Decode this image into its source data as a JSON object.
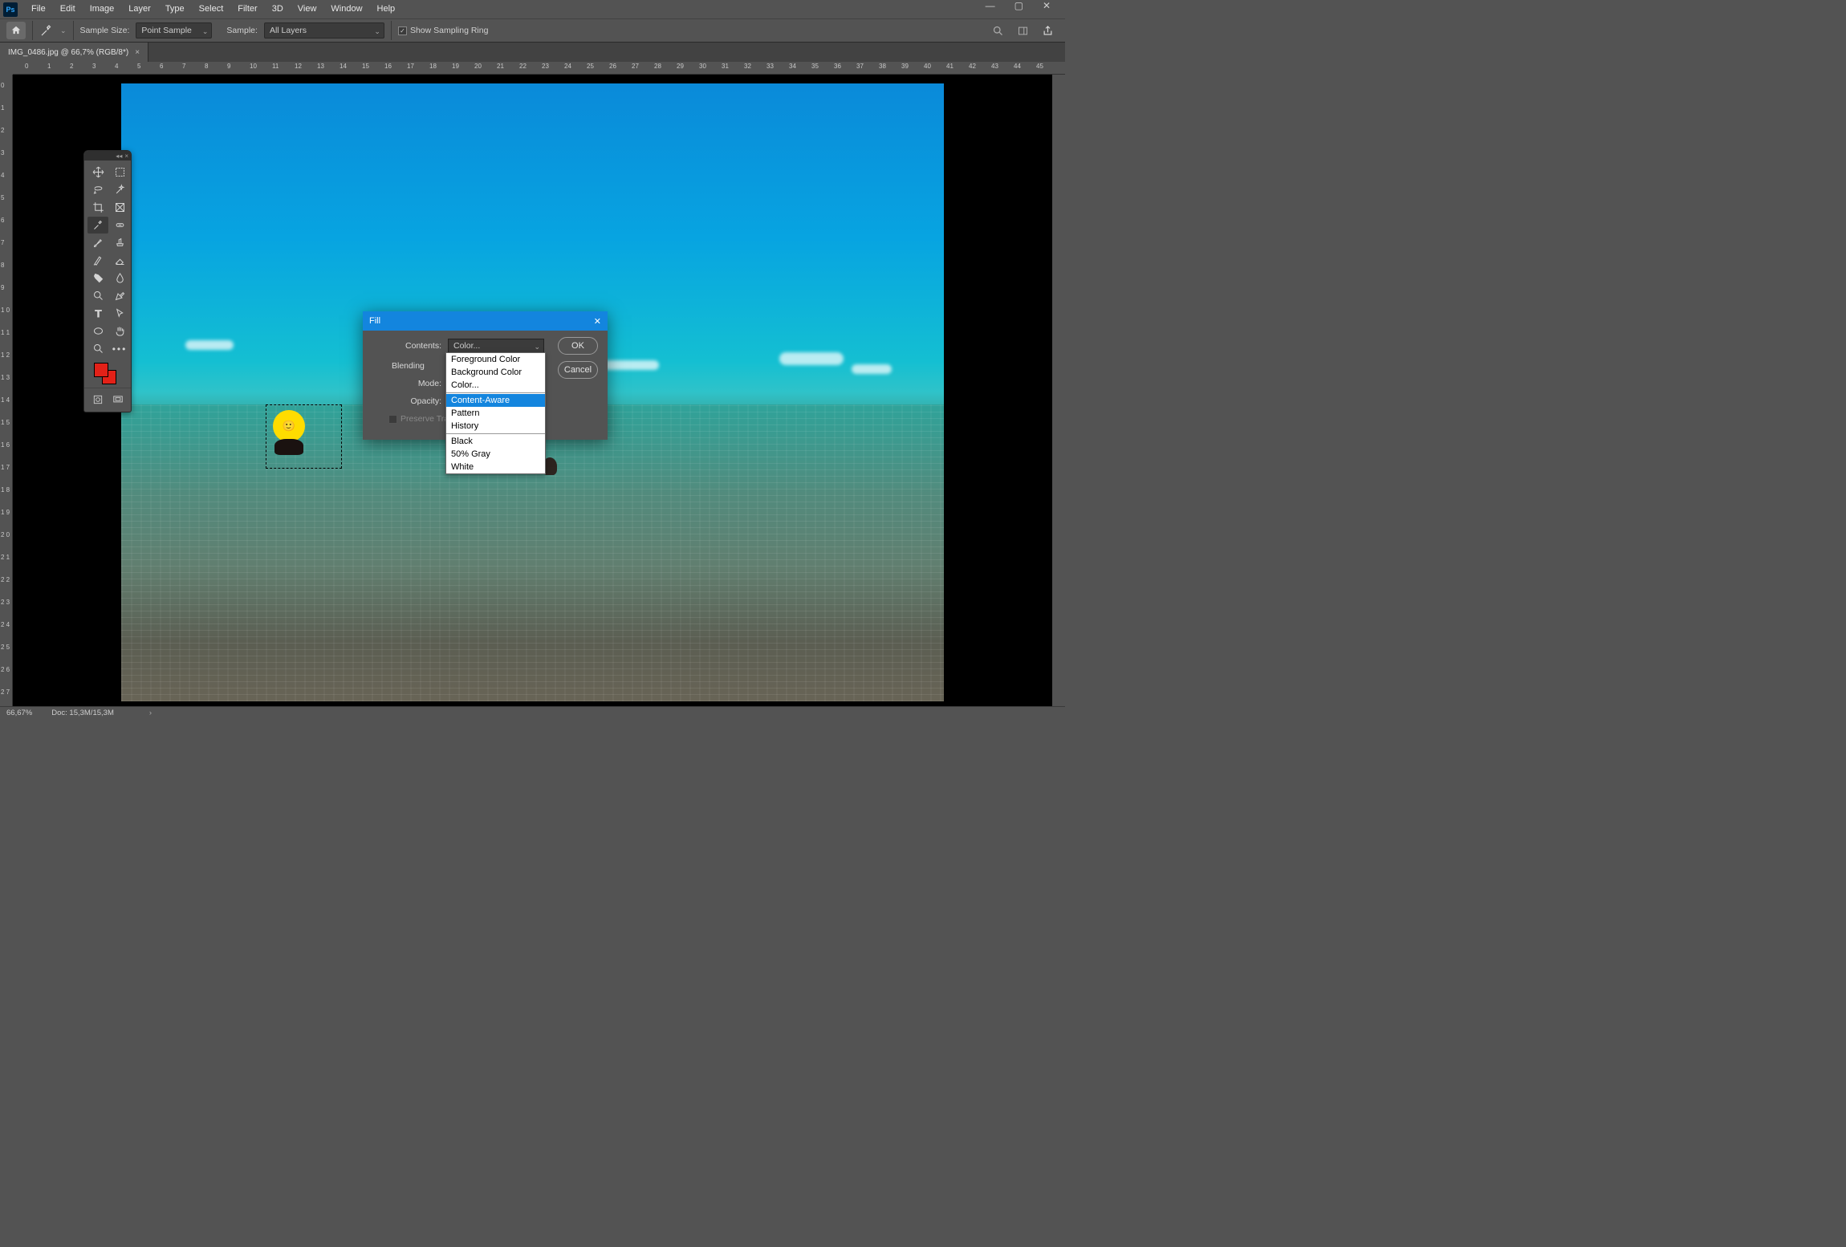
{
  "menu": [
    "File",
    "Edit",
    "Image",
    "Layer",
    "Type",
    "Select",
    "Filter",
    "3D",
    "View",
    "Window",
    "Help"
  ],
  "optbar": {
    "sample_size_label": "Sample Size:",
    "sample_size_value": "Point Sample",
    "sample_label": "Sample:",
    "sample_value": "All Layers",
    "show_ring_label": "Show Sampling Ring"
  },
  "tab": {
    "title": "IMG_0486.jpg @ 66,7% (RGB/8*)"
  },
  "ruler_ticks": [
    "0",
    "1",
    "2",
    "3",
    "4",
    "5",
    "6",
    "7",
    "8",
    "9",
    "10",
    "11",
    "12",
    "13",
    "14",
    "15",
    "16",
    "17",
    "18",
    "19",
    "20",
    "21",
    "22",
    "23",
    "24",
    "25",
    "26",
    "27",
    "28",
    "29",
    "30",
    "31",
    "32",
    "33",
    "34",
    "35",
    "36",
    "37",
    "38",
    "39",
    "40",
    "41",
    "42",
    "43",
    "44",
    "45"
  ],
  "ruler_ticks_v": [
    "0",
    "1",
    "2",
    "3",
    "4",
    "5",
    "6",
    "7",
    "8",
    "9",
    "1 0",
    "1 1",
    "1 2",
    "1 3",
    "1 4",
    "1 5",
    "1 6",
    "1 7",
    "1 8",
    "1 9",
    "2 0",
    "2 1",
    "2 2",
    "2 3",
    "2 4",
    "2 5",
    "2 6",
    "2 7"
  ],
  "swatches": {
    "fg": "#e32118",
    "bg": "#e32118"
  },
  "dialog": {
    "title": "Fill",
    "contents_label": "Contents:",
    "contents_value": "Color...",
    "blending_label": "Blending",
    "mode_label": "Mode:",
    "opacity_label": "Opacity:",
    "preserve_label": "Preserve Tran",
    "ok": "OK",
    "cancel": "Cancel"
  },
  "dropdown": {
    "group1": [
      "Foreground Color",
      "Background Color",
      "Color..."
    ],
    "group2": [
      "Content-Aware",
      "Pattern",
      "History"
    ],
    "group3": [
      "Black",
      "50% Gray",
      "White"
    ],
    "hover": "Content-Aware"
  },
  "status": {
    "zoom": "66,67%",
    "doc": "Doc: 15,3M/15,3M"
  }
}
